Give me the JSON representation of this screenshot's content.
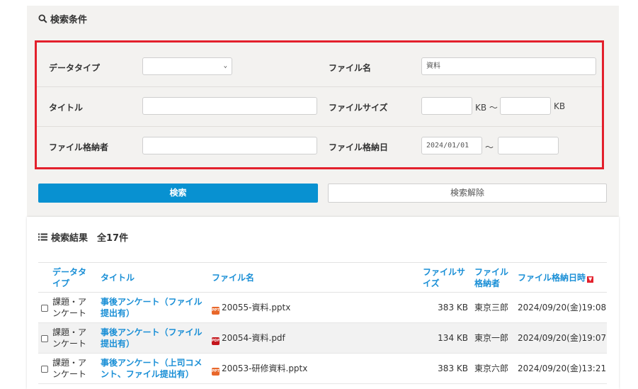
{
  "search_conditions": {
    "title": "検索条件",
    "fields": {
      "data_type": {
        "label": "データタイプ",
        "value": ""
      },
      "file_name": {
        "label": "ファイル名",
        "value": "資料"
      },
      "title": {
        "label": "タイトル",
        "value": ""
      },
      "file_size": {
        "label": "ファイルサイズ",
        "from": "",
        "to": "",
        "unit_from": "KB ～",
        "unit_to": "KB"
      },
      "file_owner": {
        "label": "ファイル格納者",
        "value": ""
      },
      "file_date": {
        "label": "ファイル格納日",
        "from": "2024/01/01",
        "to": "",
        "separator": "～"
      }
    },
    "search_button": "検索",
    "clear_button": "検索解除"
  },
  "results": {
    "title": "検索結果　全17件",
    "columns": {
      "data_type": "データタイプ",
      "title": "タイトル",
      "file_name": "ファイル名",
      "file_size": "ファイルサイズ",
      "owner": "ファイル格納者",
      "date": "ファイル格納日時"
    },
    "rows": [
      {
        "data_type": "課題・アンケート",
        "title": "事後アンケート（ファイル提出有）",
        "file_name": "20055-資料.pptx",
        "file_type": "pptx",
        "file_size": "383 KB",
        "owner": "東京三郎",
        "date": "2024/09/20(金)19:08"
      },
      {
        "data_type": "課題・アンケート",
        "title": "事後アンケート（ファイル提出有）",
        "file_name": "20054-資料.pdf",
        "file_type": "pdf",
        "file_size": "134 KB",
        "owner": "東京一郎",
        "date": "2024/09/20(金)19:07"
      },
      {
        "data_type": "課題・アンケート",
        "title": "事後アンケート（上司コメント、ファイル提出有）",
        "file_name": "20053-研修資料.pptx",
        "file_type": "pptx",
        "file_size": "383 KB",
        "owner": "東京六郎",
        "date": "2024/09/20(金)13:21"
      }
    ]
  },
  "colors": {
    "accent": "#0891d1",
    "link": "#1a8fd6",
    "highlight_border": "#e3202c",
    "pptx_icon": "#e8672a",
    "pdf_icon": "#c4161c"
  }
}
